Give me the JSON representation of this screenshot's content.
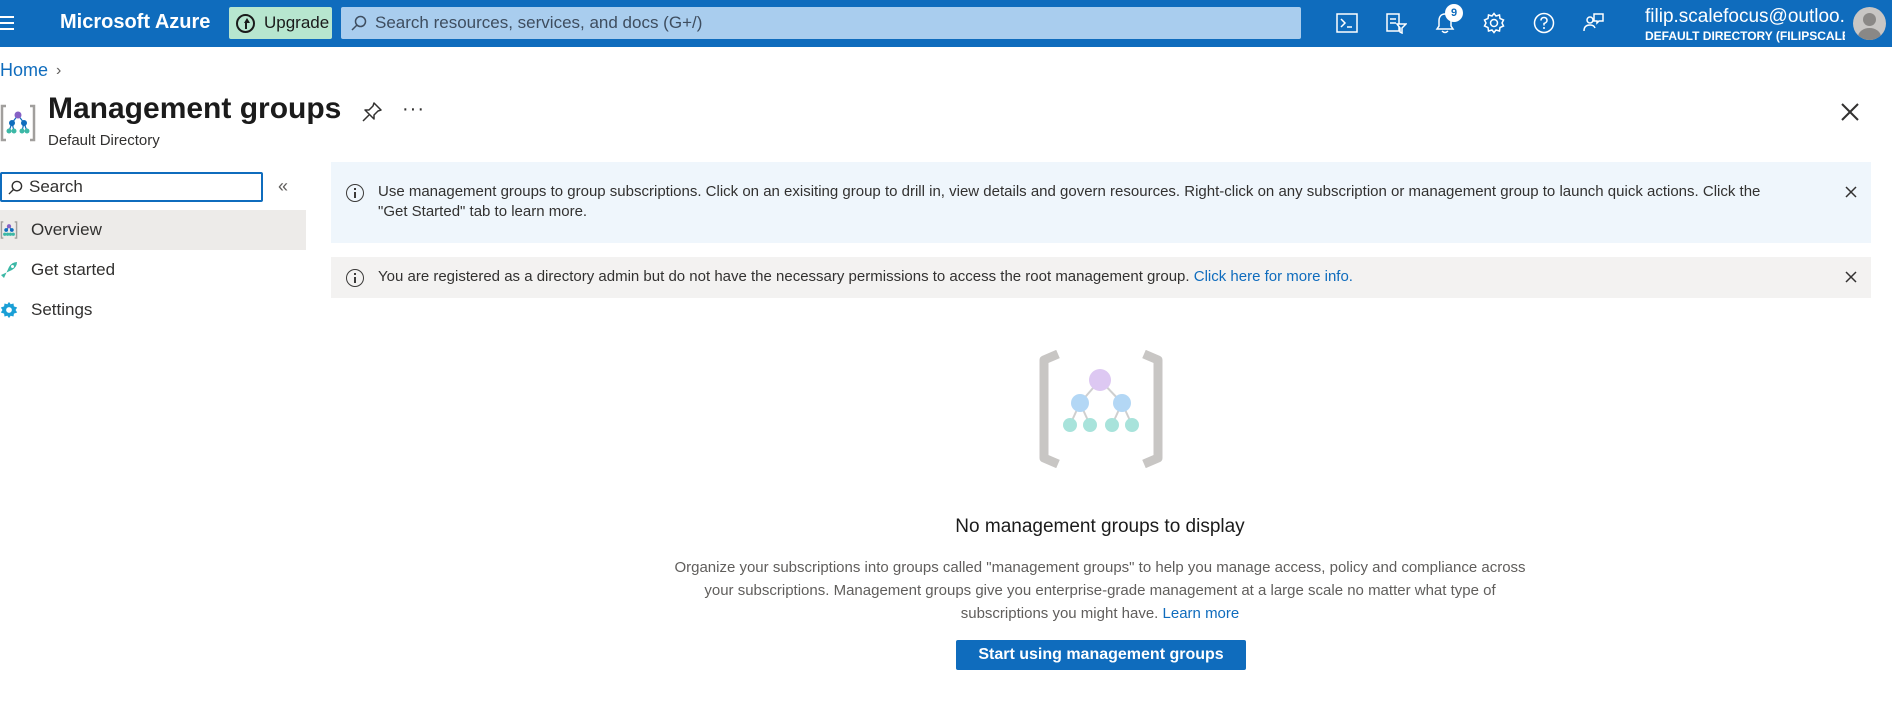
{
  "topbar": {
    "brand": "Microsoft Azure",
    "upgrade_label": "Upgrade",
    "search_placeholder": "Search resources, services, and docs (G+/)",
    "notification_count": "9",
    "user_email": "filip.scalefocus@outloo...",
    "user_directory": "DEFAULT DIRECTORY (FILIPSCALE..."
  },
  "breadcrumb": {
    "home": "Home"
  },
  "header": {
    "title": "Management groups",
    "subtitle": "Default Directory",
    "more": "···"
  },
  "sidebar": {
    "search_placeholder": "Search",
    "collapse": "«",
    "items": [
      {
        "label": "Overview",
        "active": true
      },
      {
        "label": "Get started",
        "active": false
      },
      {
        "label": "Settings",
        "active": false
      }
    ]
  },
  "banners": {
    "info_text": "Use management groups to group subscriptions. Click on an exisiting group to drill in, view details and govern resources. Right-click on any subscription or management group to launch quick actions. Click the \"Get Started\" tab to learn more.",
    "warn_text": "You are registered as a directory admin but do not have the necessary permissions to access the root management group.",
    "warn_link": "Click here for more info."
  },
  "empty_state": {
    "title": "No management groups to display",
    "description": "Organize your subscriptions into groups called \"management groups\" to help you manage access, policy and compliance across your subscriptions. Management groups give you enterprise-grade management at a large scale no matter what type of subscriptions you might have.",
    "learn_more": "Learn more",
    "cta_label": "Start using management groups"
  },
  "colors": {
    "topbar": "#0f6cbd",
    "accent": "#0f6cbd",
    "upgrade_bg": "#b7e6cf",
    "info_banner": "#eff6fc",
    "warn_banner": "#f3f2f1"
  }
}
